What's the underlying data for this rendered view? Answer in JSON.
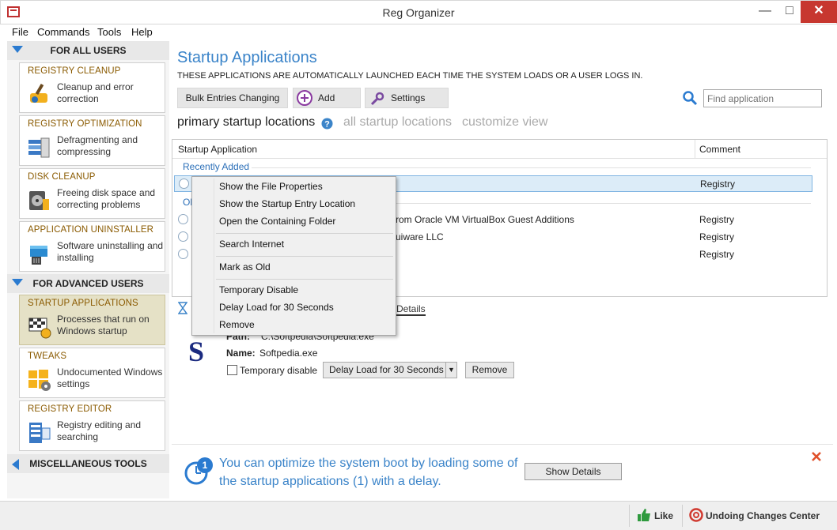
{
  "window": {
    "title": "Reg Organizer",
    "minimize": "—",
    "maximize": "□",
    "close": "✕"
  },
  "menu": [
    {
      "label": "File"
    },
    {
      "label": "Commands"
    },
    {
      "label": "Tools"
    },
    {
      "label": "Help"
    }
  ],
  "sidebar": {
    "for_all_users": "FOR ALL USERS",
    "for_advanced_users": "FOR ADVANCED USERS",
    "misc_tools": "MISCELLANEOUS TOOLS",
    "items": [
      {
        "title": "REGISTRY CLEANUP",
        "desc": "Cleanup and error correction"
      },
      {
        "title": "REGISTRY OPTIMIZATION",
        "desc": "Defragmenting and compressing"
      },
      {
        "title": "DISK CLEANUP",
        "desc": "Freeing disk space and correcting problems"
      },
      {
        "title": "APPLICATION UNINSTALLER",
        "desc": "Software uninstalling and installing"
      },
      {
        "title": "STARTUP APPLICATIONS",
        "desc": "Processes that run on Windows startup"
      },
      {
        "title": "TWEAKS",
        "desc": "Undocumented Windows settings"
      },
      {
        "title": "REGISTRY EDITOR",
        "desc": "Registry editing and searching"
      }
    ]
  },
  "main": {
    "title": "Startup Applications",
    "subtitle": "THESE APPLICATIONS ARE AUTOMATICALLY LAUNCHED EACH TIME THE SYSTEM LOADS OR A USER LOGS IN.",
    "toolbar": {
      "bulk": "Bulk Entries Changing",
      "add": "Add",
      "settings": "Settings"
    },
    "search_placeholder": "Find application",
    "view_tabs": {
      "primary": "primary startup locations",
      "all": "all startup locations",
      "customize": "customize view"
    },
    "list": {
      "col_app": "Startup Application",
      "col_comment": "Comment",
      "group_recent": "Recently Added",
      "group_other_partial": "Ol",
      "rows": [
        {
          "app": "",
          "comment": "Registry"
        },
        {
          "app": "rom Oracle VM VirtualBox Guest Additions",
          "comment": "Registry"
        },
        {
          "app": "uiware LLC",
          "comment": "Registry"
        },
        {
          "app": "",
          "comment": "Registry"
        }
      ]
    },
    "context_menu": [
      "Show the File Properties",
      "Show the Startup Entry Location",
      "Open the Containing Folder",
      "Search Internet",
      "Mark as Old",
      "Temporary Disable",
      "Delay Load for 30 Seconds",
      "Remove"
    ],
    "details": {
      "tab_label": "Details",
      "path_label": "Path:",
      "path_value": "C:\\Softpedia\\Softpedia.exe",
      "name_label": "Name:",
      "name_value": "Softpedia.exe",
      "temp_disable": "Temporary disable",
      "delay_option": "Delay Load for 30 Seconds",
      "remove": "Remove"
    },
    "tip": {
      "badge": "1",
      "text": "You can optimize the system boot by loading some of the startup applications (1) with a delay.",
      "button": "Show Details"
    }
  },
  "statusbar": {
    "like": "Like",
    "undo_center": "Undoing Changes Center"
  },
  "colors": {
    "accent": "#3b84c9",
    "section_title": "#8a5a00",
    "close_red": "#c7372f"
  }
}
